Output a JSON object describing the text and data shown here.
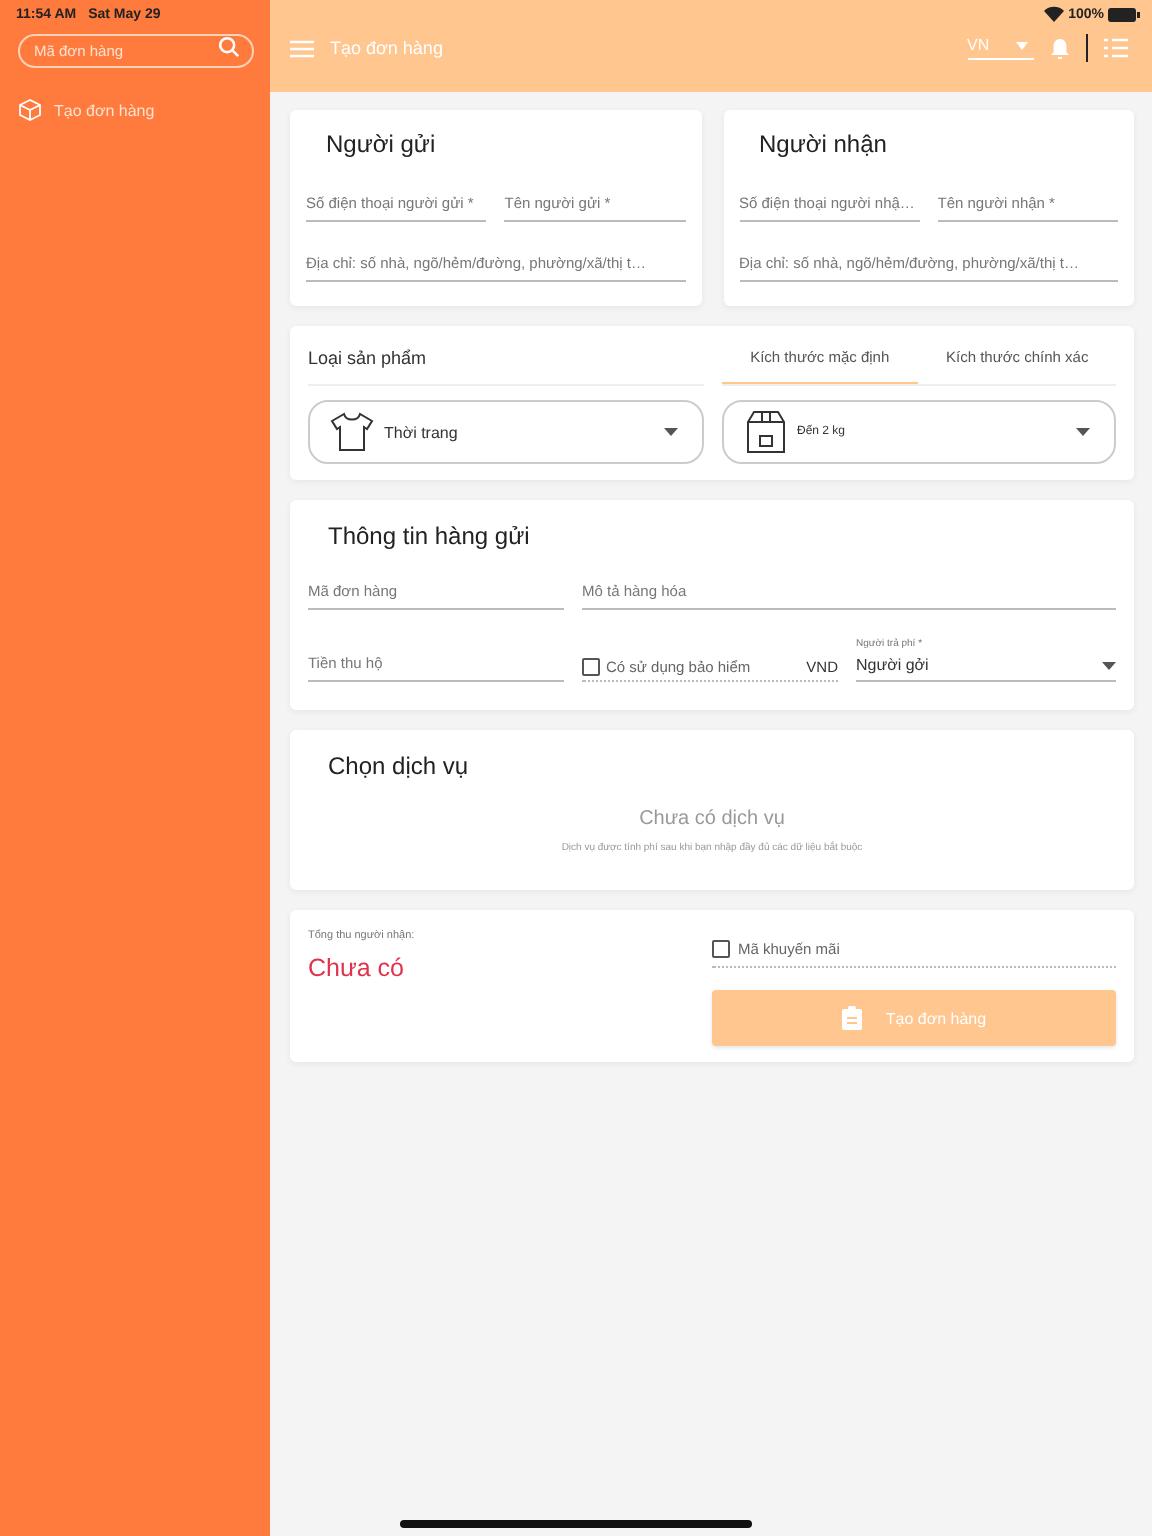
{
  "status_bar": {
    "time": "11:54 AM",
    "date": "Sat May 29",
    "battery": "100%"
  },
  "sidebar": {
    "search_placeholder": "Mã đơn hàng",
    "items": [
      {
        "label": "Tạo đơn hàng"
      }
    ]
  },
  "header": {
    "title": "Tạo đơn hàng",
    "language": "VN"
  },
  "sender": {
    "title": "Người gửi",
    "fields": [
      {
        "placeholder": "Số điện thoại người gửi *"
      },
      {
        "placeholder": "Tên người gửi *"
      },
      {
        "placeholder": "Địa chỉ: số nhà, ngõ/hẻm/đường, phường/xã/thị t…"
      }
    ]
  },
  "receiver": {
    "title": "Người nhận",
    "fields": [
      {
        "placeholder": "Số điện thoại người nhậ…"
      },
      {
        "placeholder": "Tên người nhận *"
      },
      {
        "placeholder": "Địa chỉ: số nhà, ngõ/hẻm/đường, phường/xã/thị t…"
      }
    ]
  },
  "product": {
    "label": "Loại sản phẩm",
    "tabs": [
      {
        "label": "Kích thước mặc định",
        "selected": true
      },
      {
        "label": "Kích thước chính xác",
        "selected": false
      }
    ],
    "category": "Thời trang",
    "size": "Đến 2 kg"
  },
  "shipment": {
    "title": "Thông tin hàng gửi",
    "order_code_placeholder": "Mã đơn hàng",
    "description_placeholder": "Mô tả hàng hóa",
    "cod_placeholder": "Tiền thu hộ",
    "insurance": {
      "label": "Có sử dụng bảo hiểm",
      "checked": false,
      "unit": "VND"
    },
    "payer": {
      "label": "Người trả phí *",
      "value": "Người gởi"
    }
  },
  "service": {
    "title": "Chọn dịch vụ",
    "empty_title": "Chưa có dịch vụ",
    "empty_hint": "Dịch vụ được tính phí sau khi bạn nhập đầy đủ các dữ liệu bắt buộc"
  },
  "summary": {
    "total_label": "Tổng thu người nhận:",
    "total_value": "Chưa có",
    "promo": {
      "label": "Mã khuyến mãi",
      "checked": false
    },
    "submit": {
      "label": "Tạo đơn hàng",
      "disabled": true
    }
  }
}
